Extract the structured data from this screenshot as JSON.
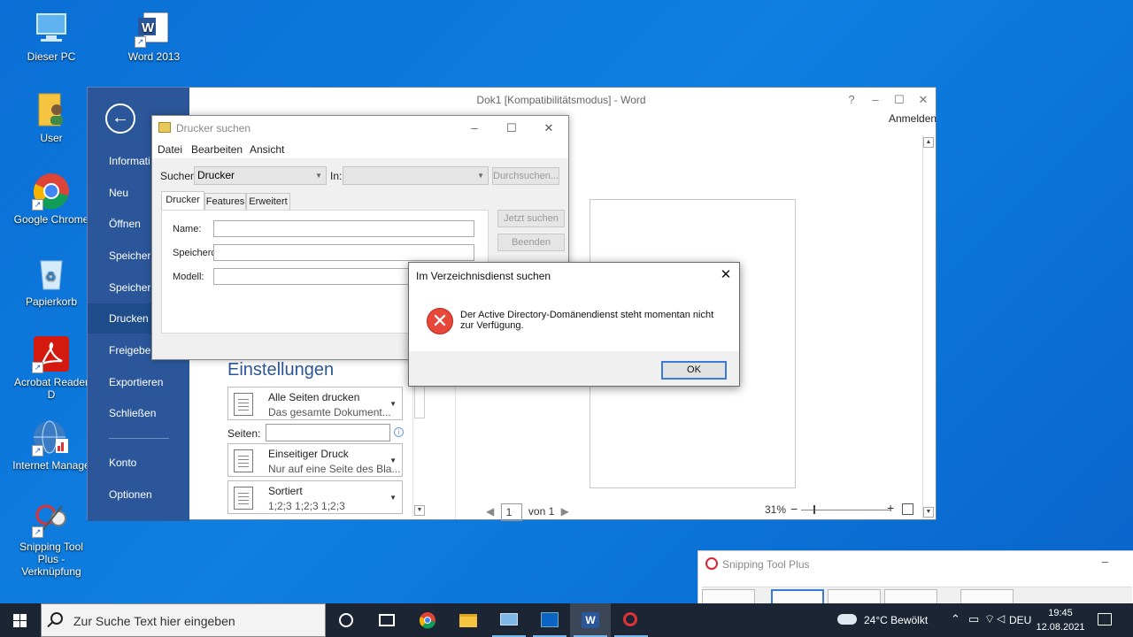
{
  "desktop": {
    "icons": [
      {
        "label": "Dieser PC",
        "icon": "computer-icon"
      },
      {
        "label": "Word 2013",
        "icon": "word-icon"
      },
      {
        "label": "User",
        "icon": "user-folder-icon"
      },
      {
        "label": "Google Chrome",
        "icon": "chrome-icon"
      },
      {
        "label": "Papierkorb",
        "icon": "recycle-bin-icon"
      },
      {
        "label": "Acrobat Reader D",
        "icon": "acrobat-icon"
      },
      {
        "label": "Internet Manage",
        "icon": "internet-manager-icon"
      },
      {
        "label": "Snipping Tool Plus - Verknüpfung",
        "icon": "snipping-tool-icon"
      }
    ]
  },
  "word": {
    "title": "Dok1 [Kompatibilitätsmodus] - Word",
    "controls": {
      "help": "?",
      "minimize": "–",
      "maximize": "☐",
      "close": "✕"
    },
    "signin": "Anmelden",
    "backstage": [
      "Informati",
      "Neu",
      "Öffnen",
      "Speichern",
      "Speichern",
      "Drucken",
      "Freigeben",
      "Exportieren",
      "Schließen",
      "Konto",
      "Optionen"
    ],
    "active_item": "Drucken",
    "settings": {
      "heading": "Einstellungen",
      "pages_box": {
        "line1": "Alle Seiten drucken",
        "line2": "Das gesamte Dokument..."
      },
      "pages_label": "Seiten:",
      "sides_box": {
        "line1": "Einseitiger Druck",
        "line2": "Nur auf eine Seite des Bla..."
      },
      "collate_box": {
        "line1": "Sortiert",
        "line2": "1;2;3    1;2;3    1;2;3"
      }
    },
    "preview": {
      "page_current": "1",
      "page_total": "von 1",
      "zoom": "31%"
    }
  },
  "printer_dialog": {
    "title": "Drucker suchen",
    "menu": [
      "Datei",
      "Bearbeiten",
      "Ansicht"
    ],
    "search_label": "Suchen:",
    "search_value": "Drucker",
    "in_label": "In:",
    "in_value": "",
    "browse_button": "Durchsuchen...",
    "tabs": [
      "Drucker",
      "Features",
      "Erweitert"
    ],
    "fields": {
      "name": "Name:",
      "location": "Speicherc",
      "model": "Modell:"
    },
    "search_now": "Jetzt suchen",
    "stop": "Beenden"
  },
  "error_dialog": {
    "title": "Im Verzeichnisdienst suchen",
    "message": "Der Active Directory-Domänendienst steht momentan nicht zur Verfügung.",
    "ok": "OK"
  },
  "snipping_tool": {
    "title": "Snipping Tool Plus"
  },
  "taskbar": {
    "search_placeholder": "Zur Suche Text hier eingeben",
    "weather": "24°C  Bewölkt",
    "language": "DEU",
    "time": "19:45",
    "date": "12.08.2021"
  },
  "colors": {
    "word_blue": "#2b579a",
    "desktop": "#0f7fe0",
    "taskbar": "#1b2534",
    "error_red": "#e8483a"
  }
}
